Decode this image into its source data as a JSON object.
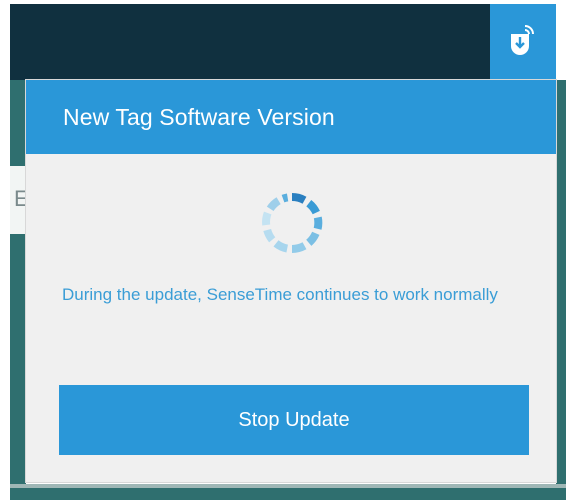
{
  "popup": {
    "title": "New Tag Software Version",
    "message": "During the update, SenseTime continues to work normally",
    "stop_button_label": "Stop Update"
  },
  "background": {
    "partial_letter": "E"
  },
  "icons": {
    "update": "download-icon",
    "spinner": "loading-spinner-icon"
  },
  "colors": {
    "accent": "#2a97d8",
    "header_dark": "#10303f",
    "body_bg": "#f0f0f0",
    "message_text": "#3a9dd6"
  }
}
